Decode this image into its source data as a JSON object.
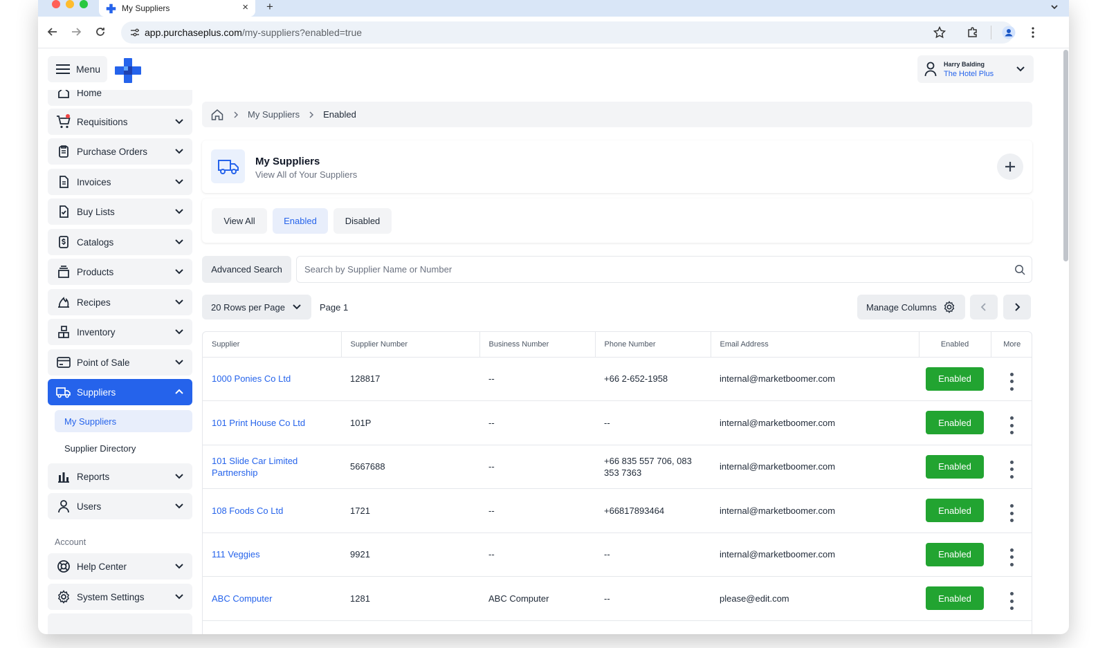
{
  "browser": {
    "tab_title": "My Suppliers",
    "tab_close": "×",
    "new_tab": "+",
    "url_host": "app.purchaseplus.com",
    "url_path": "/my-suppliers?enabled=true",
    "colors": {
      "close": "#ff5f57",
      "minimize": "#febc2e",
      "zoom": "#28c840",
      "tabstrip": "#d9e6f7"
    }
  },
  "header": {
    "menu_label": "Menu",
    "user_name": "Harry Balding",
    "user_org": "The Hotel Plus",
    "brand_color": "#2563eb"
  },
  "sidebar": {
    "items": [
      {
        "label": "Home",
        "icon": "home-icon"
      },
      {
        "label": "Requisitions",
        "icon": "cart-icon"
      },
      {
        "label": "Purchase Orders",
        "icon": "clipboard-icon"
      },
      {
        "label": "Invoices",
        "icon": "document-icon"
      },
      {
        "label": "Buy Lists",
        "icon": "checklist-icon"
      },
      {
        "label": "Catalogs",
        "icon": "dollar-doc-icon"
      },
      {
        "label": "Products",
        "icon": "products-icon"
      },
      {
        "label": "Recipes",
        "icon": "flame-icon"
      },
      {
        "label": "Inventory",
        "icon": "boxes-icon"
      },
      {
        "label": "Point of Sale",
        "icon": "card-icon"
      },
      {
        "label": "Suppliers",
        "icon": "truck-icon"
      },
      {
        "label": "Reports",
        "icon": "chart-icon"
      },
      {
        "label": "Users",
        "icon": "user-icon"
      }
    ],
    "sub_items": [
      "My Suppliers",
      "Supplier Directory"
    ],
    "account_label": "Account",
    "account_items": [
      {
        "label": "Help Center",
        "icon": "lifebuoy-icon"
      },
      {
        "label": "System Settings",
        "icon": "gear-icon"
      }
    ]
  },
  "breadcrumb": {
    "level1": "My Suppliers",
    "level2": "Enabled"
  },
  "page": {
    "title": "My Suppliers",
    "subtitle": "View All of Your Suppliers"
  },
  "filters": {
    "view_all": "View All",
    "enabled": "Enabled",
    "disabled": "Disabled"
  },
  "search": {
    "advanced_label": "Advanced Search",
    "placeholder": "Search by Supplier Name or Number",
    "value": ""
  },
  "pagination": {
    "rows_label": "20 Rows per Page",
    "page_label": "Page 1",
    "manage_label": "Manage Columns"
  },
  "table": {
    "headers": {
      "supplier": "Supplier",
      "number": "Supplier Number",
      "business": "Business Number",
      "phone": "Phone Number",
      "email": "Email Address",
      "enabled": "Enabled",
      "more": "More"
    },
    "rows": [
      {
        "supplier": "1000 Ponies Co Ltd",
        "number": "128817",
        "business": "--",
        "phone": "+66 2-652-1958",
        "email": "internal@marketboomer.com",
        "status": "Enabled"
      },
      {
        "supplier": "101 Print House Co Ltd",
        "number": "101P",
        "business": "--",
        "phone": "--",
        "email": "internal@marketboomer.com",
        "status": "Enabled"
      },
      {
        "supplier": "101 Slide Car Limited Partnership",
        "number": "5667688",
        "business": "--",
        "phone": "+66 835 557 706, 083 353 7363",
        "email": "internal@marketboomer.com",
        "status": "Enabled"
      },
      {
        "supplier": "108 Foods Co Ltd",
        "number": "1721",
        "business": "--",
        "phone": "+66817893464",
        "email": "internal@marketboomer.com",
        "status": "Enabled"
      },
      {
        "supplier": "111 Veggies",
        "number": "9921",
        "business": "--",
        "phone": "--",
        "email": "internal@marketboomer.com",
        "status": "Enabled"
      },
      {
        "supplier": "ABC Computer",
        "number": "1281",
        "business": "ABC Computer",
        "phone": "--",
        "email": "please@edit.com",
        "status": "Enabled"
      }
    ],
    "status_color": "#22a431"
  }
}
